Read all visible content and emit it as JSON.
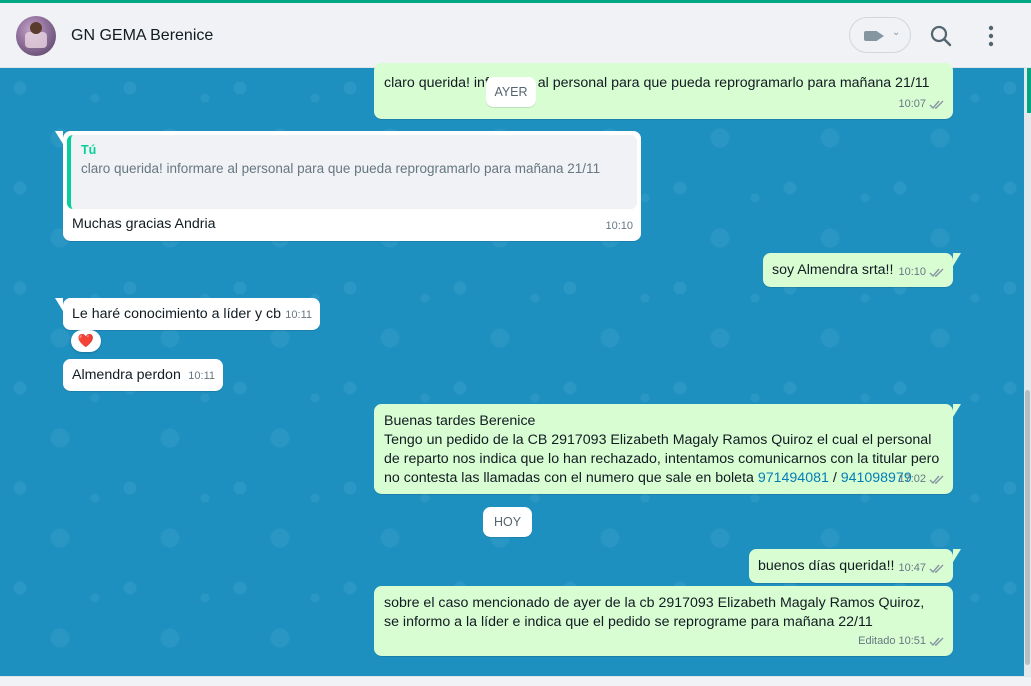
{
  "header": {
    "contact_name": "GN GEMA Berenice",
    "video_icon": "video-camera-icon",
    "search_icon": "search-icon",
    "menu_icon": "kebab-menu-icon"
  },
  "dates": {
    "yesterday": "AYER",
    "today": "HOY"
  },
  "messages": [
    {
      "direction": "out",
      "text": "claro querida! informare al personal para que pueda reprogramarlo para mañana 21/11",
      "time": "10:07",
      "status": "read"
    },
    {
      "direction": "in",
      "quote_author": "Tú",
      "quote_text": "claro querida! informare al personal para que pueda reprogramarlo para mañana 21/11",
      "text": "Muchas gracias Andria",
      "time": "10:10"
    },
    {
      "direction": "out",
      "text": "soy Almendra srta!!",
      "time": "10:10",
      "status": "read"
    },
    {
      "direction": "in",
      "text": "Le haré conocimiento a líder y cb",
      "time": "10:11",
      "reaction": "❤️"
    },
    {
      "direction": "in",
      "text": "Almendra perdon",
      "time": "10:11"
    },
    {
      "direction": "out",
      "line1": "Buenas tardes Berenice",
      "line2": "Tengo un pedido de la CB 2917093 Elizabeth Magaly Ramos Quiroz el cual el personal de reparto nos indica que lo han rechazado, intentamos comunicarnos con la titular pero no contesta las llamadas con el numero que sale en boleta",
      "phone1": "971494081",
      "separator": " / ",
      "phone2": "941098979",
      "time": "17:02",
      "status": "read"
    },
    {
      "direction": "out",
      "text": "buenos días querida!!",
      "time": "10:47",
      "status": "read"
    },
    {
      "direction": "out",
      "text": "sobre el caso mencionado de ayer de la cb 2917093 Elizabeth Magaly Ramos Quiroz, se informo a la líder e indica que el pedido se reprograme para mañana 22/11",
      "edited_label": "Editado",
      "time": "10:51",
      "status": "read"
    }
  ],
  "colors": {
    "outgoing": "#d9fdd3",
    "incoming": "#ffffff",
    "wallpaper": "#1e90c0",
    "accent": "#00a884",
    "read_ticks": "#8696a0"
  }
}
